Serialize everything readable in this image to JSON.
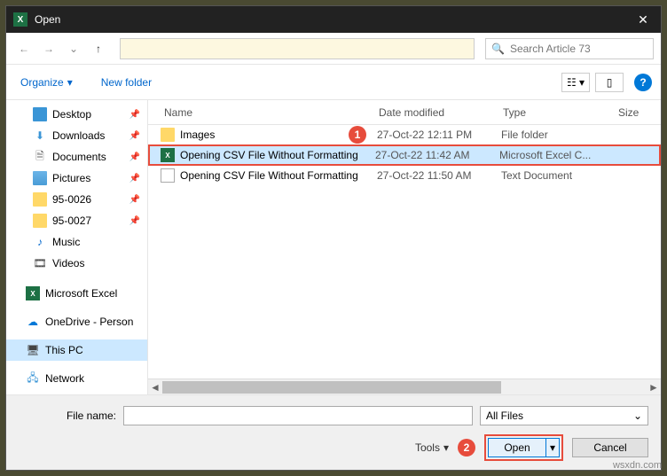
{
  "title": "Open",
  "search_placeholder": "Search Article 73",
  "toolbar": {
    "organize": "Organize",
    "newfolder": "New folder"
  },
  "columns": {
    "name": "Name",
    "date": "Date modified",
    "type": "Type",
    "size": "Size"
  },
  "sidebar": [
    {
      "label": "Desktop",
      "pin": true
    },
    {
      "label": "Downloads",
      "pin": true
    },
    {
      "label": "Documents",
      "pin": true
    },
    {
      "label": "Pictures",
      "pin": true
    },
    {
      "label": "95-0026",
      "pin": true
    },
    {
      "label": "95-0027",
      "pin": true
    },
    {
      "label": "Music",
      "pin": false
    },
    {
      "label": "Videos",
      "pin": false
    },
    {
      "label": "Microsoft Excel",
      "pin": false
    },
    {
      "label": "OneDrive - Person",
      "pin": false
    },
    {
      "label": "This PC",
      "pin": false
    },
    {
      "label": "Network",
      "pin": false
    }
  ],
  "files": [
    {
      "name": "Images",
      "date": "27-Oct-22 12:11 PM",
      "type": "File folder"
    },
    {
      "name": "Opening CSV File Without Formatting",
      "date": "27-Oct-22 11:42 AM",
      "type": "Microsoft Excel C..."
    },
    {
      "name": "Opening CSV File Without Formatting",
      "date": "27-Oct-22 11:50 AM",
      "type": "Text Document"
    }
  ],
  "bottom": {
    "filename_label": "File name:",
    "filter": "All Files",
    "tools": "Tools",
    "open": "Open",
    "cancel": "Cancel"
  },
  "markers": {
    "m1": "1",
    "m2": "2"
  },
  "watermark": "wsxdn.com"
}
